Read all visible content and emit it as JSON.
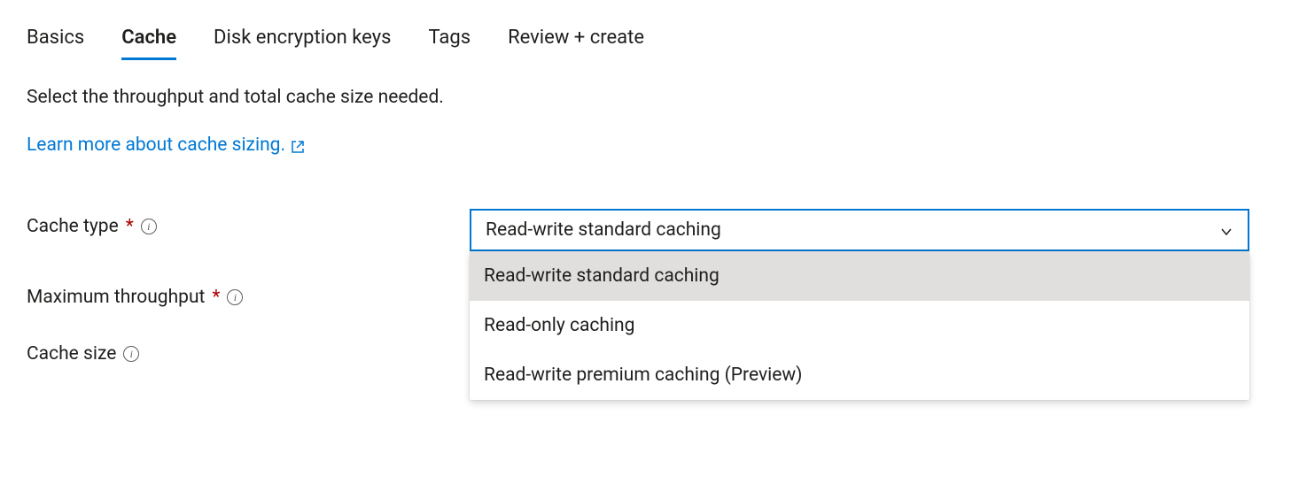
{
  "tabs": [
    {
      "label": "Basics"
    },
    {
      "label": "Cache"
    },
    {
      "label": "Disk encryption keys"
    },
    {
      "label": "Tags"
    },
    {
      "label": "Review + create"
    }
  ],
  "description": "Select the throughput and total cache size needed.",
  "learnMore": {
    "text": "Learn more about cache sizing."
  },
  "fields": {
    "cacheType": {
      "label": "Cache type",
      "selected": "Read-write standard caching",
      "options": [
        "Read-write standard caching",
        "Read-only caching",
        "Read-write premium caching (Preview)"
      ]
    },
    "maxThroughput": {
      "label": "Maximum throughput"
    },
    "cacheSize": {
      "label": "Cache size"
    }
  }
}
